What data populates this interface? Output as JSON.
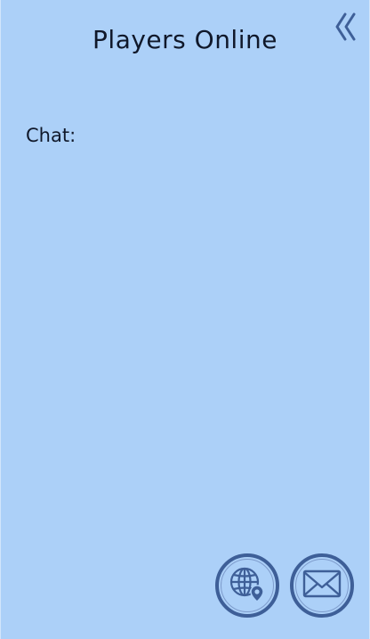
{
  "header": {
    "title": "Players Online",
    "collapse_icon": "double-chevron-left-icon"
  },
  "chat": {
    "label": "Chat:",
    "messages": []
  },
  "actions": [
    {
      "name": "map-button",
      "icon": "globe-location-icon"
    },
    {
      "name": "messages-button",
      "icon": "envelope-icon"
    }
  ],
  "colors": {
    "panel_background": "#acd0f8",
    "icon_primary": "#3e5f98",
    "text": "#10182a"
  }
}
